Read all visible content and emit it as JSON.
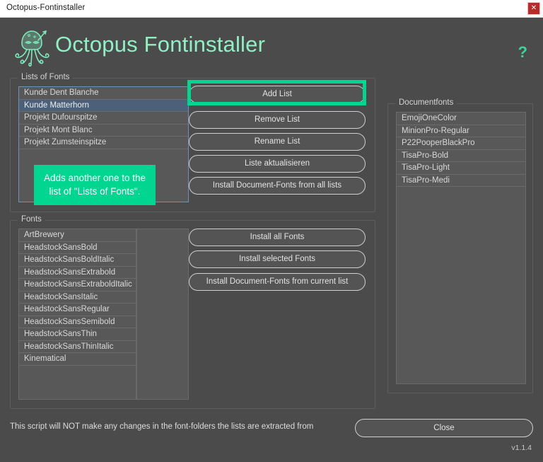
{
  "window": {
    "title": "Octopus-Fontinstaller",
    "close_glyph": "✕"
  },
  "header": {
    "app_title": "Octopus Fontinstaller",
    "help_glyph": "?",
    "logo_name": "octopus-logo",
    "accent_color": "#8ef0c4",
    "help_color": "#3fd39a"
  },
  "lists_of_fonts": {
    "label": "Lists of Fonts",
    "items": [
      {
        "label": "Kunde Dent Blanche",
        "selected": false
      },
      {
        "label": "Kunde Matterhorn",
        "selected": true
      },
      {
        "label": "Projekt Dufourspitze",
        "selected": false
      },
      {
        "label": "Projekt Mont Blanc",
        "selected": false
      },
      {
        "label": "Projekt Zumsteinspitze",
        "selected": false
      }
    ],
    "buttons": [
      "Add List",
      "Remove List",
      "Rename List",
      "Liste aktualisieren",
      "Install Document-Fonts from all lists"
    ]
  },
  "fonts": {
    "label": "Fonts",
    "items": [
      "ArtBrewery",
      "HeadstockSansBold",
      "HeadstockSansBoldItalic",
      "HeadstockSansExtrabold",
      "HeadstockSansExtraboldItalic",
      "HeadstockSansItalic",
      "HeadstockSansRegular",
      "HeadstockSansSemibold",
      "HeadstockSansThin",
      "HeadstockSansThinItalic",
      "Kinematical"
    ],
    "secondary_items": [],
    "buttons": [
      "Install all Fonts",
      "Install selected Fonts",
      "Install Document-Fonts from current list"
    ]
  },
  "documentfonts": {
    "label": "Documentfonts",
    "items": [
      "EmojiOneColor",
      "MinionPro-Regular",
      "P22PooperBlackPro",
      "TisaPro-Bold",
      "TisaPro-Light",
      "TisaPro-Medi"
    ]
  },
  "tooltip": {
    "text": "Adds another one to the list of \"Lists of Fonts\".",
    "color": "#00d68f"
  },
  "footer": {
    "note": "This script will NOT make any changes in the font-folders the lists are extracted from",
    "close_label": "Close",
    "version": "v1.1.4"
  }
}
